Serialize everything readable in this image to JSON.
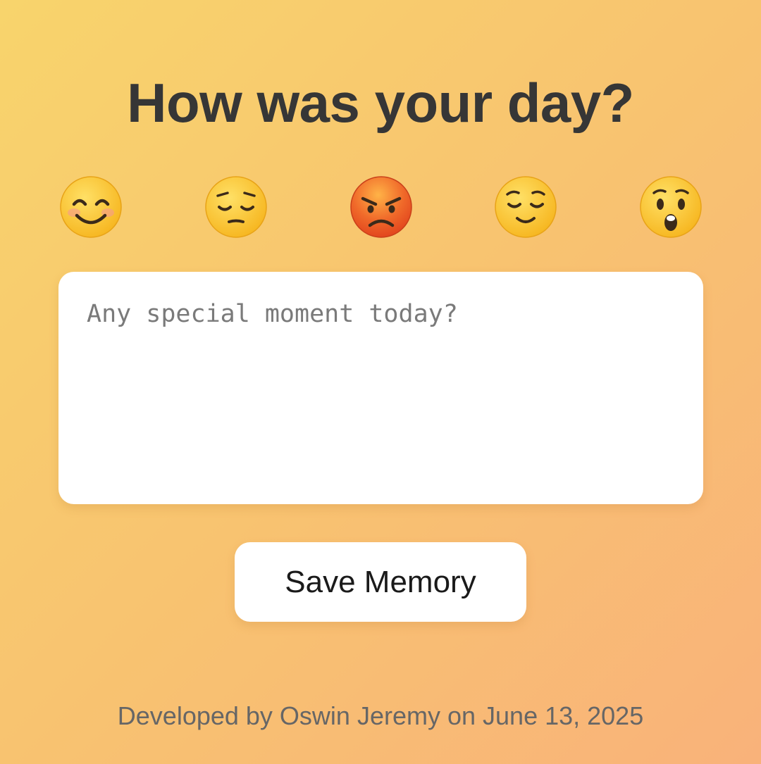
{
  "header": {
    "title": "How was your day?"
  },
  "moods": [
    {
      "icon": "smiling-face-with-smiling-eyes-icon",
      "selected": false
    },
    {
      "icon": "pensive-face-icon",
      "selected": false
    },
    {
      "icon": "angry-face-icon",
      "selected": true
    },
    {
      "icon": "relieved-face-icon",
      "selected": false
    },
    {
      "icon": "astonished-face-icon",
      "selected": false
    }
  ],
  "memory": {
    "value": "",
    "placeholder": "Any special moment today?"
  },
  "actions": {
    "save_label": "Save Memory"
  },
  "footer": {
    "text": "Developed by Oswin Jeremy on June 13, 2025"
  },
  "colors": {
    "background_start": "#f8d46c",
    "background_end": "#f9b27a",
    "title": "#363636",
    "footer_text": "#666666",
    "card": "#ffffff"
  }
}
